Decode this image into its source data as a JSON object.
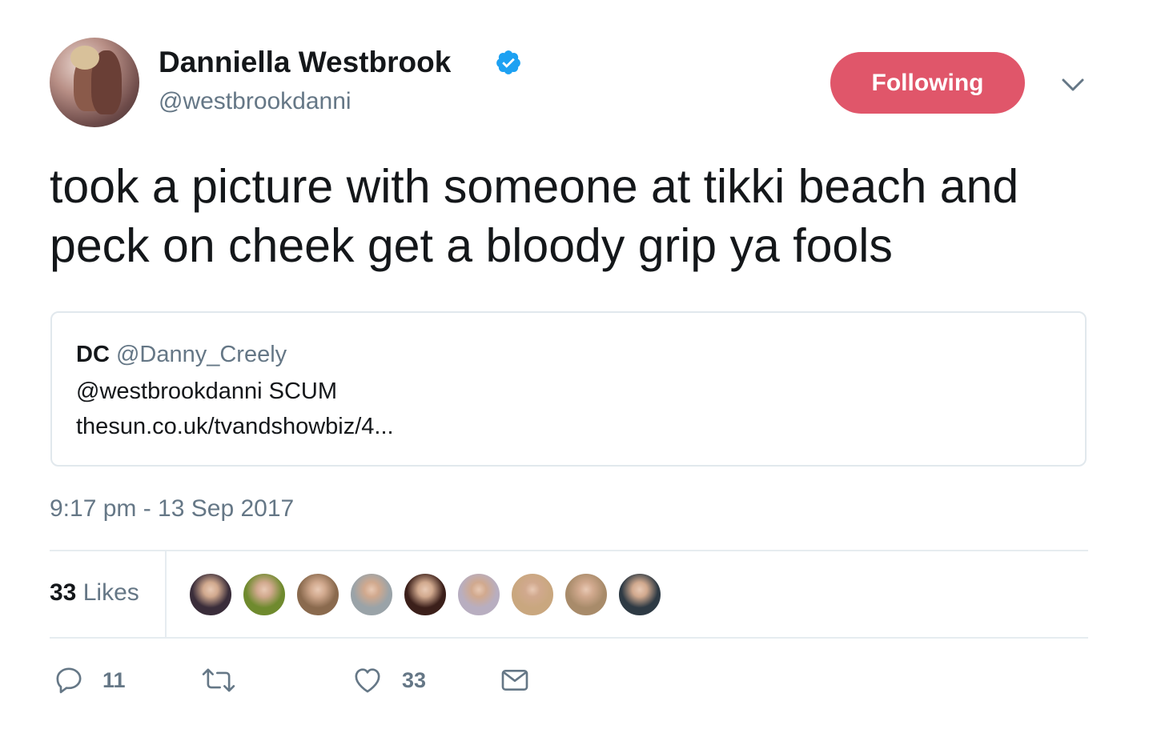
{
  "author": {
    "display_name": "Danniella Westbrook",
    "handle": "@westbrookdanni",
    "verified": true,
    "avatar_icon": "profile-photo"
  },
  "follow_button": {
    "label": "Following",
    "color": "#e0566a"
  },
  "menu_icon": "chevron-down-icon",
  "tweet": {
    "text": "took a picture with someone at tikki beach and peck on cheek get a bloody grip ya fools",
    "timestamp": "9:17 pm - 13 Sep 2017"
  },
  "quoted_tweet": {
    "name": "DC",
    "handle": "@Danny_Creely",
    "line1": "@westbrookdanni SCUM",
    "line2": "thesun.co.uk/tvandshowbiz/4..."
  },
  "stats": {
    "likes_count": "33",
    "likes_label": "Likes",
    "likers": [
      {
        "name": "liker-1",
        "color": "#3a2d3a"
      },
      {
        "name": "liker-2",
        "color": "#6f8a2e"
      },
      {
        "name": "liker-3",
        "color": "#8a6a4e"
      },
      {
        "name": "liker-4",
        "color": "#9aa3a8"
      },
      {
        "name": "liker-5",
        "color": "#3b1f1a"
      },
      {
        "name": "liker-6",
        "color": "#b8aec0"
      },
      {
        "name": "liker-7",
        "color": "#c9a77f"
      },
      {
        "name": "liker-8",
        "color": "#a88b6a"
      },
      {
        "name": "liker-9",
        "color": "#2e3a44"
      }
    ]
  },
  "actions": {
    "reply": {
      "icon": "reply-icon",
      "count": "11"
    },
    "retweet": {
      "icon": "retweet-icon",
      "count": ""
    },
    "like": {
      "icon": "heart-icon",
      "count": "33"
    },
    "message": {
      "icon": "envelope-icon",
      "count": ""
    }
  },
  "colors": {
    "text": "#14171a",
    "secondary": "#657786",
    "verified": "#1da1f2",
    "border": "#e1e8ed"
  }
}
